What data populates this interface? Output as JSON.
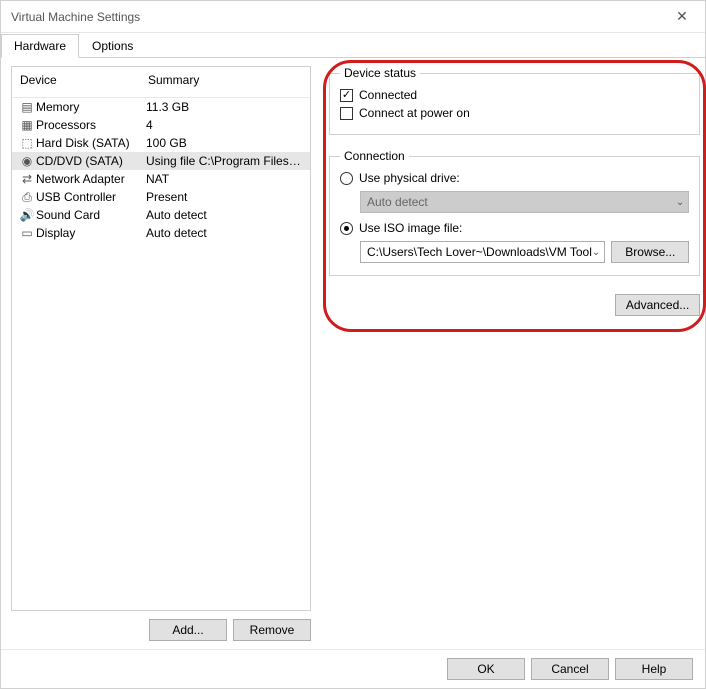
{
  "window": {
    "title": "Virtual Machine Settings"
  },
  "tabs": {
    "hardware": "Hardware",
    "options": "Options"
  },
  "device_list": {
    "header_device": "Device",
    "header_summary": "Summary",
    "rows": [
      {
        "icon": "memory-icon",
        "label": "Memory",
        "summary": "11.3 GB",
        "selected": false
      },
      {
        "icon": "cpu-icon",
        "label": "Processors",
        "summary": "4",
        "selected": false
      },
      {
        "icon": "disk-icon",
        "label": "Hard Disk (SATA)",
        "summary": "100 GB",
        "selected": false
      },
      {
        "icon": "disc-icon",
        "label": "CD/DVD (SATA)",
        "summary": "Using file C:\\Program Files (x...",
        "selected": true
      },
      {
        "icon": "network-icon",
        "label": "Network Adapter",
        "summary": "NAT",
        "selected": false
      },
      {
        "icon": "usb-icon",
        "label": "USB Controller",
        "summary": "Present",
        "selected": false
      },
      {
        "icon": "sound-icon",
        "label": "Sound Card",
        "summary": "Auto detect",
        "selected": false
      },
      {
        "icon": "display-icon",
        "label": "Display",
        "summary": "Auto detect",
        "selected": false
      }
    ],
    "add_button": "Add...",
    "remove_button": "Remove"
  },
  "device_status": {
    "legend": "Device status",
    "connected_label": "Connected",
    "connected_checked": true,
    "power_on_label": "Connect at power on",
    "power_on_checked": false
  },
  "connection": {
    "legend": "Connection",
    "physical_label": "Use physical drive:",
    "physical_selected": false,
    "physical_value": "Auto detect",
    "iso_label": "Use ISO image file:",
    "iso_selected": true,
    "iso_path": "C:\\Users\\Tech Lover~\\Downloads\\VM Tool",
    "browse_button": "Browse..."
  },
  "advanced_button": "Advanced...",
  "bottom": {
    "ok": "OK",
    "cancel": "Cancel",
    "help": "Help"
  },
  "icons": {
    "memory-icon": "▤",
    "cpu-icon": "▦",
    "disk-icon": "⬚",
    "disc-icon": "◉",
    "network-icon": "⇄",
    "usb-icon": "⎙",
    "sound-icon": "🔊",
    "display-icon": "▭",
    "chevron-down": "⌄"
  }
}
